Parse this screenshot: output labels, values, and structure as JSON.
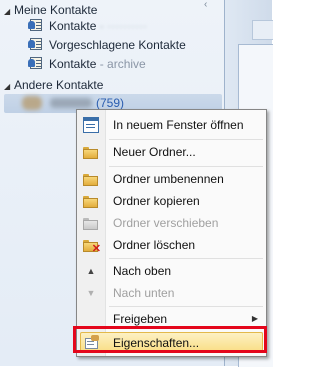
{
  "nav": {
    "my_contacts_header": "Meine Kontakte",
    "folders": [
      {
        "label": "Kontakte",
        "sub": "",
        "blurred_suffix": true
      },
      {
        "label": "Vorgeschlagene Kontakte",
        "sub": ""
      },
      {
        "label": "Kontakte",
        "sub": " - archive"
      }
    ],
    "other_contacts_header": "Andere Kontakte",
    "account_count": "(759)"
  },
  "context_menu": {
    "items": [
      {
        "label": "In neuem Fenster öffnen",
        "icon": "new-window-icon",
        "enabled": true
      },
      {
        "label": "Neuer Ordner...",
        "icon": "new-folder-icon",
        "enabled": true
      },
      {
        "label": "Ordner umbenennen",
        "icon": "rename-folder-icon",
        "enabled": true
      },
      {
        "label": "Ordner kopieren",
        "icon": "copy-folder-icon",
        "enabled": true
      },
      {
        "label": "Ordner verschieben",
        "icon": "move-folder-icon",
        "enabled": false
      },
      {
        "label": "Ordner löschen",
        "icon": "delete-folder-icon",
        "enabled": true
      },
      {
        "label": "Nach oben",
        "icon": "move-up-icon",
        "enabled": true
      },
      {
        "label": "Nach unten",
        "icon": "move-down-icon",
        "enabled": false
      },
      {
        "label": "Freigeben",
        "icon": "",
        "enabled": true,
        "submenu": true
      },
      {
        "label": "Eigenschaften...",
        "icon": "properties-icon",
        "enabled": true,
        "highlighted": true
      }
    ]
  },
  "colors": {
    "highlight_frame": "#e4061b",
    "hover_fill": "#f9dd84",
    "account_count": "#2a5db0"
  }
}
